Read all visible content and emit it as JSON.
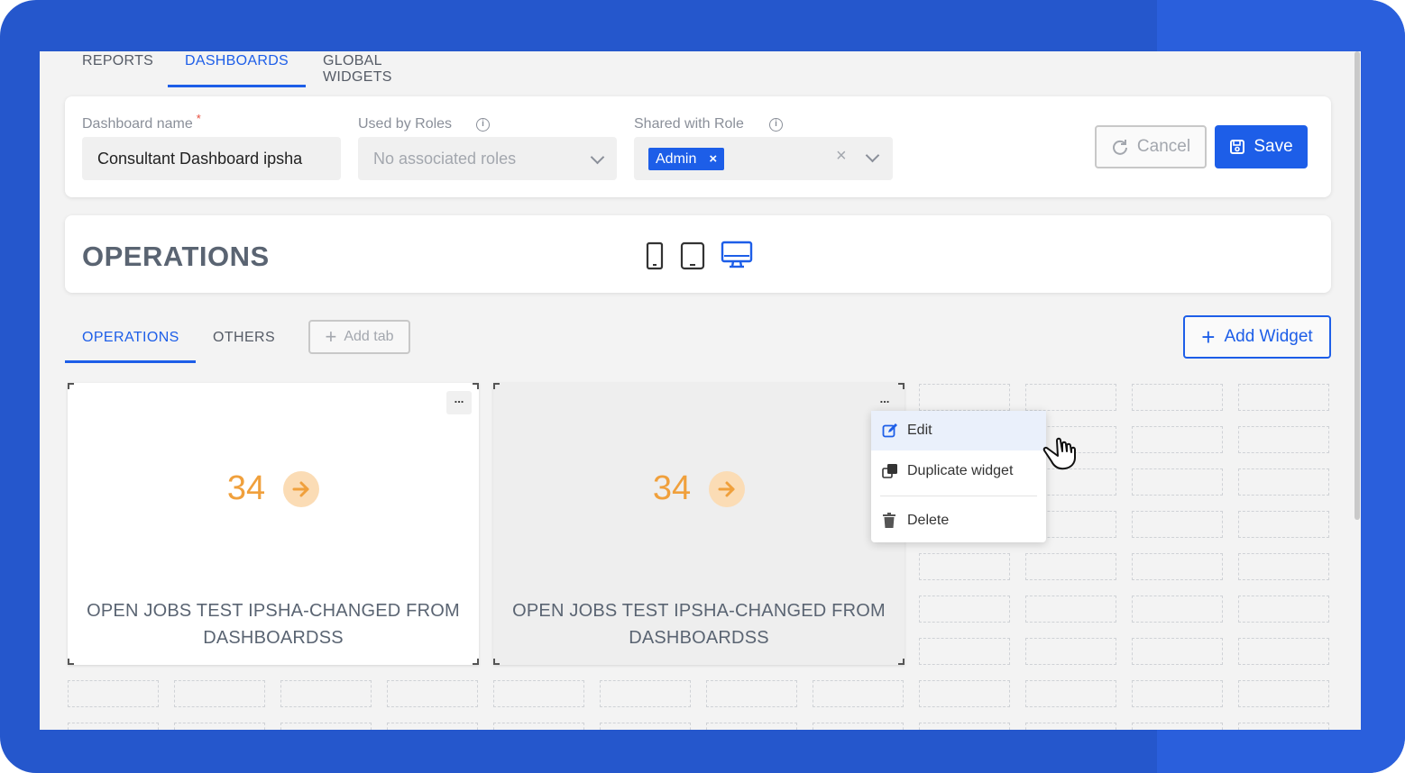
{
  "top_tabs": [
    {
      "label": "REPORTS",
      "active": false
    },
    {
      "label": "DASHBOARDS",
      "active": true
    },
    {
      "label": "GLOBAL WIDGETS",
      "active": false
    }
  ],
  "form": {
    "dashboard_name_label": "Dashboard name",
    "required_marker": "*",
    "dashboard_name_value": "Consultant Dashboard ipsha",
    "used_by_roles_label": "Used by Roles",
    "used_by_roles_placeholder": "No associated roles",
    "shared_with_role_label": "Shared with Role",
    "shared_with_role_tags": [
      "Admin"
    ],
    "cancel_label": "Cancel",
    "save_label": "Save"
  },
  "dashboard": {
    "title": "OPERATIONS",
    "device_views": [
      "phone-icon",
      "tablet-icon",
      "desktop-icon"
    ],
    "active_device": "desktop"
  },
  "sub_tabs": [
    {
      "label": "OPERATIONS",
      "active": true
    },
    {
      "label": "OTHERS",
      "active": false
    }
  ],
  "add_tab_label": "Add tab",
  "add_widget_label": "Add Widget",
  "widgets": [
    {
      "value": "34",
      "title": "OPEN JOBS TEST IPSHA-CHANGED FROM DASHBOARDSS",
      "menu_label": "..."
    },
    {
      "value": "34",
      "title": "OPEN JOBS TEST IPSHA-CHANGED FROM DASHBOARDSS",
      "menu_label": "..."
    }
  ],
  "context_menu": {
    "items": [
      {
        "label": "Edit",
        "icon": "edit-icon"
      },
      {
        "label": "Duplicate widget",
        "icon": "duplicate-icon"
      },
      {
        "label": "Delete",
        "icon": "trash-icon"
      }
    ]
  },
  "colors": {
    "accent": "#1d5ee8",
    "frame": "#2557cc",
    "metric": "#f0a03c"
  }
}
